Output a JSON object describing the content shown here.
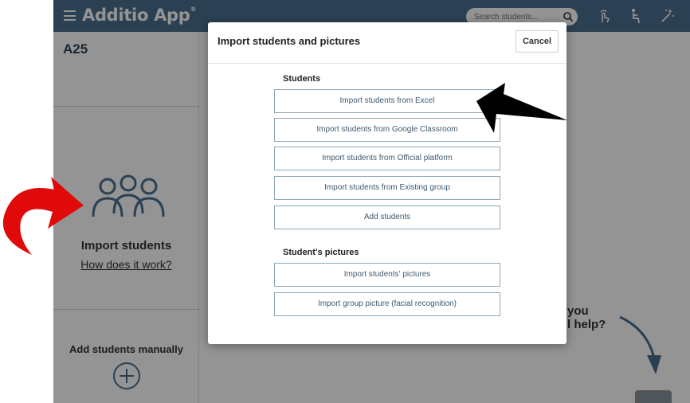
{
  "app": {
    "title": "Additio App",
    "trademark": "®",
    "search_placeholder": "Search students..."
  },
  "icons": {
    "menu": "hamburger-menu-icon",
    "search": "search-icon",
    "top": [
      "touch-icon",
      "seat-icon",
      "magic-wand-icon"
    ]
  },
  "group": {
    "name": "A25"
  },
  "left_panel": {
    "import_title": "Import students",
    "how_link": "How does it work?",
    "add_manual": "Add students manually"
  },
  "help": {
    "line1": "you",
    "line2": "l help?"
  },
  "modal": {
    "title": "Import students and pictures",
    "cancel_label": "Cancel",
    "students_section": "Students",
    "student_options": [
      "Import students from Excel",
      "Import students from Google Classroom",
      "Import students from Official platform",
      "Import students from Existing group",
      "Add students"
    ],
    "pictures_section": "Student's pictures",
    "picture_options": [
      "Import students' pictures",
      "Import group picture (facial recognition)"
    ]
  },
  "colors": {
    "topbar": "#4a6f8f",
    "button_border": "#8fa6b7",
    "button_text": "#3e5a70",
    "annotation_red": "#e10a0a",
    "annotation_black": "#000000"
  }
}
